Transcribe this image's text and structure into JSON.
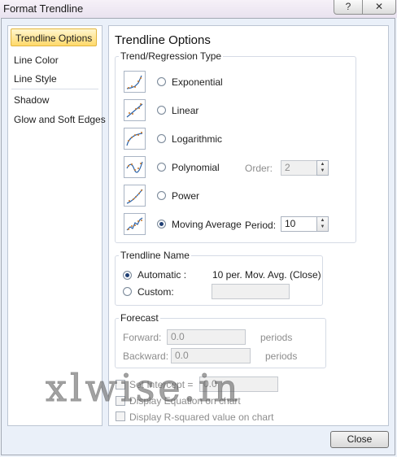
{
  "window": {
    "title": "Format Trendline",
    "help_label": "?",
    "close_label": "✕"
  },
  "sidebar": {
    "items": [
      {
        "label": "Trendline Options",
        "selected": true
      },
      {
        "label": "Line Color"
      },
      {
        "label": "Line Style"
      },
      {
        "label": "Shadow"
      },
      {
        "label": "Glow and Soft Edges"
      }
    ]
  },
  "main": {
    "heading": "Trendline Options",
    "trend_group_label": "Trend/Regression Type",
    "types": [
      {
        "label": "Exponential",
        "icon": "exponential-trend-icon",
        "selected": false
      },
      {
        "label": "Linear",
        "icon": "linear-trend-icon",
        "selected": false
      },
      {
        "label": "Logarithmic",
        "icon": "logarithmic-trend-icon",
        "selected": false
      },
      {
        "label": "Polynomial",
        "icon": "polynomial-trend-icon",
        "selected": false
      },
      {
        "label": "Power",
        "icon": "power-trend-icon",
        "selected": false
      },
      {
        "label": "Moving Average",
        "icon": "moving-average-trend-icon",
        "selected": true
      }
    ],
    "order_label": "Order:",
    "order_value": "2",
    "period_label": "Period:",
    "period_value": "10",
    "name_group_label": "Trendline Name",
    "automatic_label": "Automatic :",
    "automatic_value": "10 per. Mov. Avg. (Close)",
    "custom_label": "Custom:",
    "custom_value": "",
    "forecast_group_label": "Forecast",
    "forward_label": "Forward:",
    "forward_value": "0.0",
    "backward_label": "Backward:",
    "backward_value": "0.0",
    "periods_label": "periods",
    "set_intercept_label": "Set Intercept =",
    "set_intercept_value": "0.0",
    "display_equation_label": "Display Equation on chart",
    "display_rsquared_label": "Display R-squared value on chart"
  },
  "footer": {
    "close_label": "Close"
  },
  "watermark": "xlwise.in",
  "colors": {
    "selected_nav": "#ffd96b",
    "accent_radio": "#1f3f73"
  }
}
